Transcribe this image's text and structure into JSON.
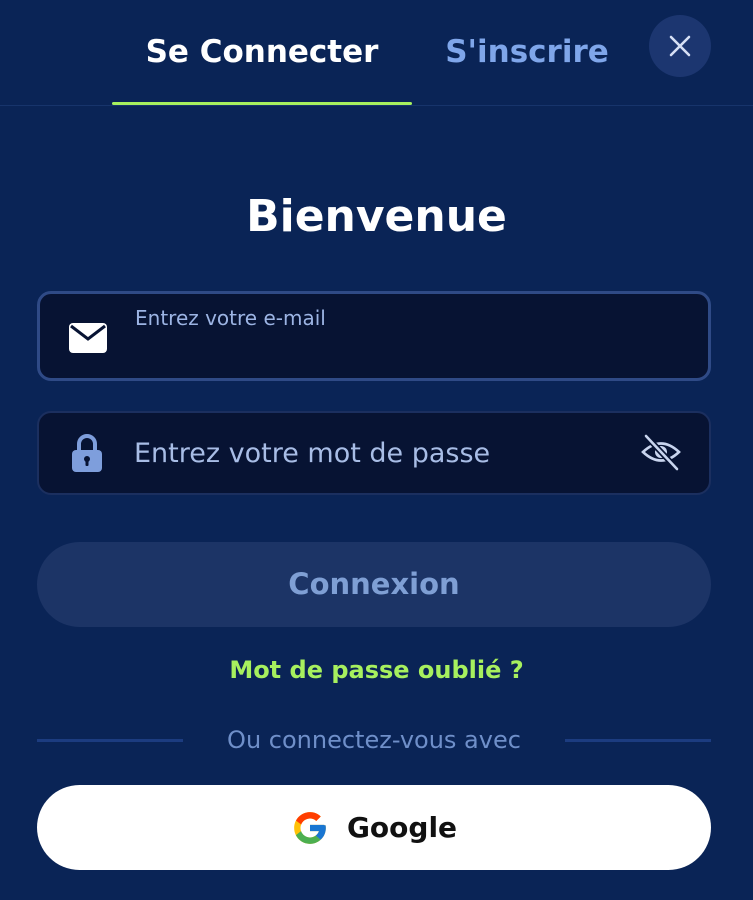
{
  "tabs": {
    "login": "Se Connecter",
    "signup": "S'inscrire"
  },
  "title": "Bienvenue",
  "email": {
    "label": "Entrez votre e-mail",
    "value": ""
  },
  "password": {
    "placeholder": "Entrez votre mot de passe",
    "value": ""
  },
  "login_button": "Connexion",
  "forgot_password": "Mot de passe oublié ?",
  "divider_text": "Ou connectez-vous avec",
  "google_button": "Google",
  "icons": {
    "close": "close-icon",
    "email": "envelope-icon",
    "password": "lock-icon",
    "visibility": "eye-off-icon",
    "google": "google-logo-icon"
  },
  "colors": {
    "background": "#0a2456",
    "accent": "#a7f05e",
    "inactive_tab": "#7fa6ea",
    "field_bg": "#071333",
    "button_disabled": "#1c3466"
  }
}
